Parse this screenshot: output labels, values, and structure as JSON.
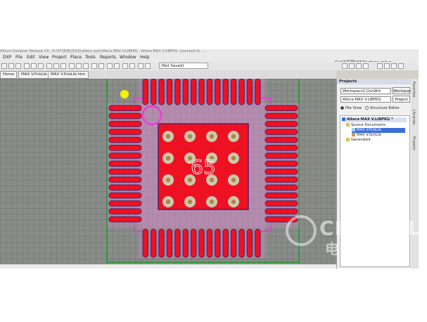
{
  "window": {
    "title": "Altium Designer Release 10 - D:\\07\\实例\\(553)\\altera cplc\\Altera MAX V.LIBPKG - Altera MAX V.LIBPKG. Licensed to ...",
    "path": "D:\\07\\实例\\(553)\\altera cplc ▾"
  },
  "menu": {
    "items": [
      "DXP",
      "File",
      "Edit",
      "View",
      "Project",
      "Place",
      "Tools",
      "Reports",
      "Window",
      "Help"
    ]
  },
  "toolbar": {
    "saved_state": "(Not Saved)"
  },
  "tabs": {
    "home": "Home",
    "pcblib": "MAX V.PcbLib",
    "pcblib_htm": "MAX V.PcbLib.htm"
  },
  "canvas": {
    "pad_number": "65",
    "pins_per_side": 15,
    "thermal_grid": "4 x 4 vias",
    "colors": {
      "pad": "#ee1122",
      "pad_outline": "#5a1a6e",
      "silkscreen": "#ee33dd",
      "board_edge": "#1f9a2a",
      "grid_background": "#8a8c8a",
      "via_ring": "#cfc8b0",
      "marker": "#f4f400"
    }
  },
  "panel": {
    "title": "Projects",
    "workspace_value": "Workspace1.DsnWrk",
    "workspace_button": "Workspace",
    "project_value": "Altera MAX V.LIBPKG",
    "project_button": "Project",
    "view_file": "File View",
    "view_structure": "Structure Editor",
    "tree": {
      "root": "Altera MAX V.LIBPKG *",
      "source_folder": "Source Documents",
      "doc1": "MAX V.PcbLib",
      "doc2": "MAX V.SchLib",
      "generated": "Generated"
    }
  },
  "sidebar": {
    "tabs": [
      "Favorites",
      "Libraries",
      "Projects"
    ]
  },
  "watermark": {
    "brand": "CIRMALL",
    "brand_cn": "电路城"
  }
}
